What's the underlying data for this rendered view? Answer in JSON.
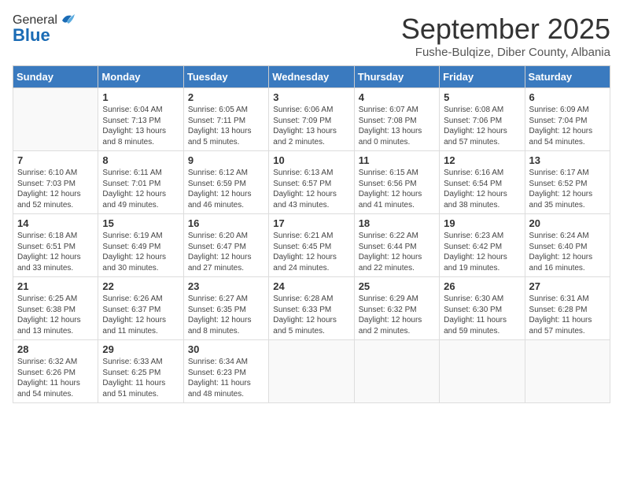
{
  "header": {
    "logo_general": "General",
    "logo_blue": "Blue",
    "month_title": "September 2025",
    "subtitle": "Fushe-Bulqize, Diber County, Albania"
  },
  "days_of_week": [
    "Sunday",
    "Monday",
    "Tuesday",
    "Wednesday",
    "Thursday",
    "Friday",
    "Saturday"
  ],
  "weeks": [
    [
      {
        "day": "",
        "text": ""
      },
      {
        "day": "1",
        "text": "Sunrise: 6:04 AM\nSunset: 7:13 PM\nDaylight: 13 hours\nand 8 minutes."
      },
      {
        "day": "2",
        "text": "Sunrise: 6:05 AM\nSunset: 7:11 PM\nDaylight: 13 hours\nand 5 minutes."
      },
      {
        "day": "3",
        "text": "Sunrise: 6:06 AM\nSunset: 7:09 PM\nDaylight: 13 hours\nand 2 minutes."
      },
      {
        "day": "4",
        "text": "Sunrise: 6:07 AM\nSunset: 7:08 PM\nDaylight: 13 hours\nand 0 minutes."
      },
      {
        "day": "5",
        "text": "Sunrise: 6:08 AM\nSunset: 7:06 PM\nDaylight: 12 hours\nand 57 minutes."
      },
      {
        "day": "6",
        "text": "Sunrise: 6:09 AM\nSunset: 7:04 PM\nDaylight: 12 hours\nand 54 minutes."
      }
    ],
    [
      {
        "day": "7",
        "text": "Sunrise: 6:10 AM\nSunset: 7:03 PM\nDaylight: 12 hours\nand 52 minutes."
      },
      {
        "day": "8",
        "text": "Sunrise: 6:11 AM\nSunset: 7:01 PM\nDaylight: 12 hours\nand 49 minutes."
      },
      {
        "day": "9",
        "text": "Sunrise: 6:12 AM\nSunset: 6:59 PM\nDaylight: 12 hours\nand 46 minutes."
      },
      {
        "day": "10",
        "text": "Sunrise: 6:13 AM\nSunset: 6:57 PM\nDaylight: 12 hours\nand 43 minutes."
      },
      {
        "day": "11",
        "text": "Sunrise: 6:15 AM\nSunset: 6:56 PM\nDaylight: 12 hours\nand 41 minutes."
      },
      {
        "day": "12",
        "text": "Sunrise: 6:16 AM\nSunset: 6:54 PM\nDaylight: 12 hours\nand 38 minutes."
      },
      {
        "day": "13",
        "text": "Sunrise: 6:17 AM\nSunset: 6:52 PM\nDaylight: 12 hours\nand 35 minutes."
      }
    ],
    [
      {
        "day": "14",
        "text": "Sunrise: 6:18 AM\nSunset: 6:51 PM\nDaylight: 12 hours\nand 33 minutes."
      },
      {
        "day": "15",
        "text": "Sunrise: 6:19 AM\nSunset: 6:49 PM\nDaylight: 12 hours\nand 30 minutes."
      },
      {
        "day": "16",
        "text": "Sunrise: 6:20 AM\nSunset: 6:47 PM\nDaylight: 12 hours\nand 27 minutes."
      },
      {
        "day": "17",
        "text": "Sunrise: 6:21 AM\nSunset: 6:45 PM\nDaylight: 12 hours\nand 24 minutes."
      },
      {
        "day": "18",
        "text": "Sunrise: 6:22 AM\nSunset: 6:44 PM\nDaylight: 12 hours\nand 22 minutes."
      },
      {
        "day": "19",
        "text": "Sunrise: 6:23 AM\nSunset: 6:42 PM\nDaylight: 12 hours\nand 19 minutes."
      },
      {
        "day": "20",
        "text": "Sunrise: 6:24 AM\nSunset: 6:40 PM\nDaylight: 12 hours\nand 16 minutes."
      }
    ],
    [
      {
        "day": "21",
        "text": "Sunrise: 6:25 AM\nSunset: 6:38 PM\nDaylight: 12 hours\nand 13 minutes."
      },
      {
        "day": "22",
        "text": "Sunrise: 6:26 AM\nSunset: 6:37 PM\nDaylight: 12 hours\nand 11 minutes."
      },
      {
        "day": "23",
        "text": "Sunrise: 6:27 AM\nSunset: 6:35 PM\nDaylight: 12 hours\nand 8 minutes."
      },
      {
        "day": "24",
        "text": "Sunrise: 6:28 AM\nSunset: 6:33 PM\nDaylight: 12 hours\nand 5 minutes."
      },
      {
        "day": "25",
        "text": "Sunrise: 6:29 AM\nSunset: 6:32 PM\nDaylight: 12 hours\nand 2 minutes."
      },
      {
        "day": "26",
        "text": "Sunrise: 6:30 AM\nSunset: 6:30 PM\nDaylight: 11 hours\nand 59 minutes."
      },
      {
        "day": "27",
        "text": "Sunrise: 6:31 AM\nSunset: 6:28 PM\nDaylight: 11 hours\nand 57 minutes."
      }
    ],
    [
      {
        "day": "28",
        "text": "Sunrise: 6:32 AM\nSunset: 6:26 PM\nDaylight: 11 hours\nand 54 minutes."
      },
      {
        "day": "29",
        "text": "Sunrise: 6:33 AM\nSunset: 6:25 PM\nDaylight: 11 hours\nand 51 minutes."
      },
      {
        "day": "30",
        "text": "Sunrise: 6:34 AM\nSunset: 6:23 PM\nDaylight: 11 hours\nand 48 minutes."
      },
      {
        "day": "",
        "text": ""
      },
      {
        "day": "",
        "text": ""
      },
      {
        "day": "",
        "text": ""
      },
      {
        "day": "",
        "text": ""
      }
    ]
  ]
}
